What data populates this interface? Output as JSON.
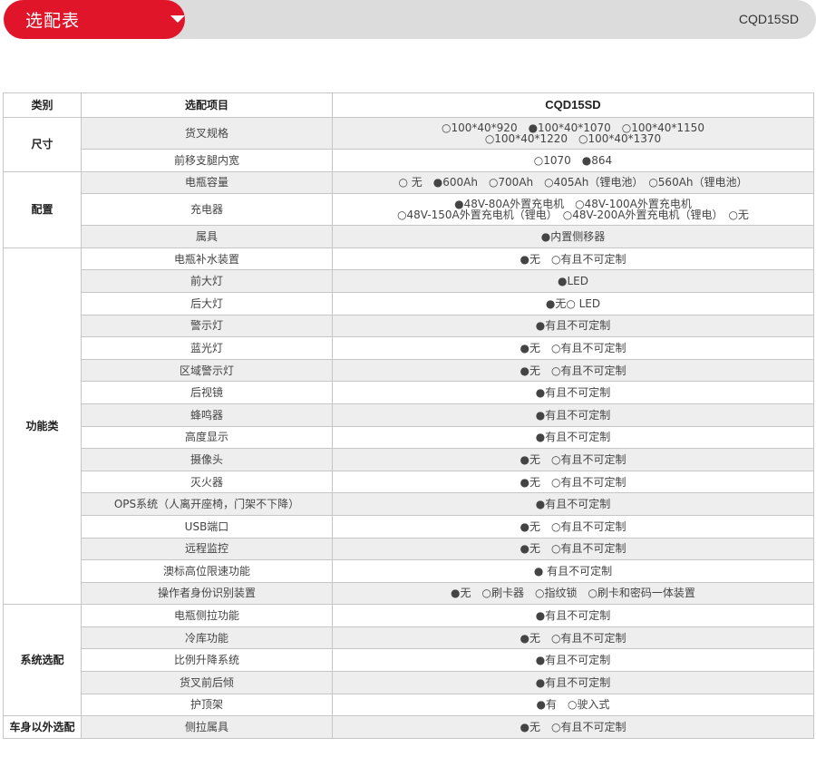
{
  "header": {
    "title": "选配表",
    "model": "CQD15SD"
  },
  "table": {
    "headers": [
      "类别",
      "选配项目",
      "CQD15SD"
    ],
    "groups": [
      {
        "category": "尺寸",
        "rows": [
          {
            "item": "货叉规格",
            "lines": [
              "○100*40*920　●100*40*1070　○100*40*1150",
              "○100*40*1220　○100*40*1370"
            ]
          },
          {
            "item": "前移支腿内宽",
            "lines": [
              "○1070　●864"
            ]
          }
        ]
      },
      {
        "category": "配置",
        "rows": [
          {
            "item": "电瓶容量",
            "lines": [
              "○ 无　●600Ah　○700Ah　○405Ah（锂电池）　○560Ah（锂电池）"
            ]
          },
          {
            "item": "充电器",
            "lines": [
              "●48V-80A外置充电机　○48V-100A外置充电机",
              "○48V-150A外置充电机（锂电）　○48V-200A外置充电机（锂电）　○无"
            ]
          },
          {
            "item": "属具",
            "lines": [
              "●内置侧移器"
            ]
          }
        ]
      },
      {
        "category": "功能类",
        "rows": [
          {
            "item": "电瓶补水装置",
            "lines": [
              "●无　○有且不可定制"
            ]
          },
          {
            "item": "前大灯",
            "lines": [
              "●LED"
            ]
          },
          {
            "item": "后大灯",
            "lines": [
              "●无○ LED"
            ]
          },
          {
            "item": "警示灯",
            "lines": [
              "●有且不可定制"
            ]
          },
          {
            "item": "蓝光灯",
            "lines": [
              "●无　○有且不可定制"
            ]
          },
          {
            "item": "区域警示灯",
            "lines": [
              "●无　○有且不可定制"
            ]
          },
          {
            "item": "后视镜",
            "lines": [
              "●有且不可定制"
            ]
          },
          {
            "item": "蜂鸣器",
            "lines": [
              "●有且不可定制"
            ]
          },
          {
            "item": "高度显示",
            "lines": [
              "●有且不可定制"
            ]
          },
          {
            "item": "摄像头",
            "lines": [
              "●无　○有且不可定制"
            ]
          },
          {
            "item": "灭火器",
            "lines": [
              "●无　○有且不可定制"
            ]
          },
          {
            "item": "OPS系统（人离开座椅，门架不下降）",
            "lines": [
              "●有且不可定制"
            ]
          },
          {
            "item": "USB端口",
            "lines": [
              "●无　○有且不可定制"
            ]
          },
          {
            "item": "远程监控",
            "lines": [
              "●无　○有且不可定制"
            ]
          },
          {
            "item": "澳标高位限速功能",
            "lines": [
              "● 有且不可定制"
            ]
          },
          {
            "item": "操作者身份识别装置",
            "lines": [
              "●无　○刷卡器　○指纹锁　○刷卡和密码一体装置"
            ]
          }
        ]
      },
      {
        "category": "系统选配",
        "rows": [
          {
            "item": "电瓶侧拉功能",
            "lines": [
              "●有且不可定制"
            ]
          },
          {
            "item": "冷库功能",
            "lines": [
              "●无　○有且不可定制"
            ]
          },
          {
            "item": "比例升降系统",
            "lines": [
              "●有且不可定制"
            ]
          },
          {
            "item": "货叉前后倾",
            "lines": [
              "●有且不可定制"
            ]
          },
          {
            "item": "护顶架",
            "lines": [
              "●有　○驶入式"
            ]
          }
        ]
      },
      {
        "category": "车身以外选配",
        "rows": [
          {
            "item": "侧拉属具",
            "lines": [
              "●无　○有且不可定制"
            ]
          }
        ]
      }
    ]
  }
}
